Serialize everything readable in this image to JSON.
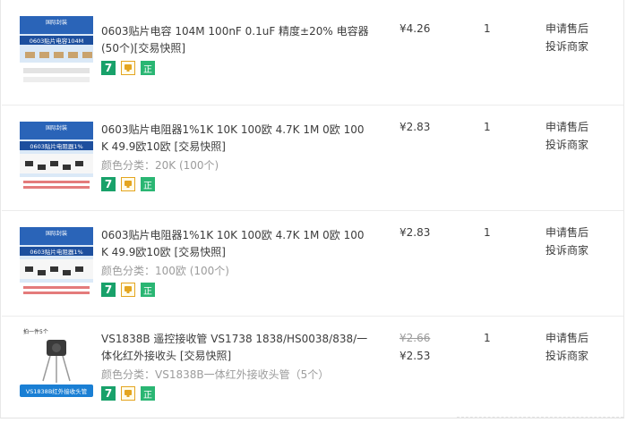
{
  "items": [
    {
      "thumb_text": [
        "国际封装",
        "0603贴片电容104M"
      ],
      "title": "0603贴片电容 104M 100nF 0.1uF 精度±20% 电容器(50个)",
      "snapshot": "[交易快照]",
      "sku": "",
      "price_old": "",
      "price": "¥4.26",
      "qty": "1",
      "op1": "申请售后",
      "op2": "投诉商家"
    },
    {
      "thumb_text": [
        "国际封装",
        "0603贴片电阻器1%"
      ],
      "title": "0603贴片电阻器1%1K 10K 100欧 4.7K 1M 0欧 100K 49.9欧10欧",
      "snapshot": "[交易快照]",
      "sku": "颜色分类：20K (100个)",
      "price_old": "",
      "price": "¥2.83",
      "qty": "1",
      "op1": "申请售后",
      "op2": "投诉商家"
    },
    {
      "thumb_text": [
        "国际封装",
        "0603贴片电阻器1%"
      ],
      "title": "0603贴片电阻器1%1K 10K 100欧 4.7K 1M 0欧 100K 49.9欧10欧",
      "snapshot": "[交易快照]",
      "sku": "颜色分类：100欧 (100个)",
      "price_old": "",
      "price": "¥2.83",
      "qty": "1",
      "op1": "申请售后",
      "op2": "投诉商家"
    },
    {
      "thumb_text": [
        "拍一件5个",
        "VS1838B红外接收头管"
      ],
      "title": "VS1838B 遥控接收管 VS1738 1838/HS0038/838/一体化红外接收头",
      "snapshot": "[交易快照]",
      "sku": "颜色分类：VS1838B一体红外接收头管（5个）",
      "price_old": "¥2.66",
      "price": "¥2.53",
      "qty": "1",
      "op1": "申请售后",
      "op2": "投诉商家"
    }
  ],
  "badges": {
    "seven": "7",
    "zheng": "正"
  },
  "colors": {
    "badge_green": "#18a16a",
    "badge_zheng": "#2ab673",
    "badge_border": "#e4a520",
    "muted": "#9c9c9c"
  }
}
